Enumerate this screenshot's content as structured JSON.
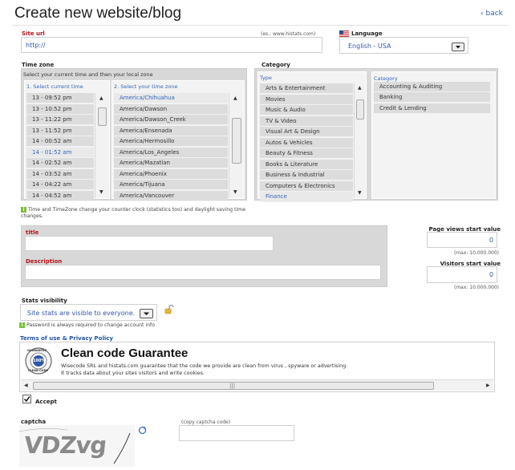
{
  "page": {
    "title": "Create new website/blog",
    "back_label": "back"
  },
  "site_url": {
    "label": "Site url",
    "example": "(es.: www.histats.com)",
    "value": "http://"
  },
  "language": {
    "label": "Language",
    "value": "English - USA"
  },
  "timezone": {
    "label": "Time zone",
    "instruction": "Select your current time and then your local zone",
    "col1_header": "1. Select current time",
    "col2_header": "2. Select your time zone",
    "times": [
      "13 - 09:52 pm",
      "13 - 10:52 pm",
      "13 - 11:22 pm",
      "13 - 11:52 pm",
      "14 - 00:52 am",
      "14 - 01:52 am",
      "14 - 02:52 am",
      "14 - 03:52 am",
      "14 - 04:22 am",
      "14 - 04:52 am"
    ],
    "zones": [
      "America/Chihuahua",
      "America/Dawson",
      "America/Dawson_Creek",
      "America/Ensenada",
      "America/Hermosillo",
      "America/Los_Angeles",
      "America/Mazatlan",
      "America/Phoenix",
      "America/Tijuana",
      "America/Vancouver"
    ],
    "note": "Time and TimeZone change your counter clock (statistics too) and daylight saving time changes."
  },
  "category": {
    "label": "Category",
    "type_header": "Type",
    "category_header": "Category",
    "types": [
      "Arts & Entertainment",
      "Movies",
      "Music & Audio",
      "TV & Video",
      "Visual Art & Design",
      "Autos & Vehicles",
      "Beauty & Fitness",
      "Books & Literature",
      "Business & Industrial",
      "Computers & Electronics",
      "Finance"
    ],
    "categories": [
      "Accounting & Auditing",
      "Banking",
      "Credit & Lending"
    ]
  },
  "title_field": {
    "label": "title",
    "value": ""
  },
  "description_field": {
    "label": "Description",
    "value": ""
  },
  "pageviews": {
    "label": "Page views start value",
    "value": "0",
    "max": "(max: 10.000.000)"
  },
  "visitors": {
    "label": "Visitors start value",
    "value": "0",
    "max": "(max: 10.000.000)"
  },
  "stats_visibility": {
    "label": "Stats visibility",
    "value": "Site stats are visible to everyone.",
    "note": "Password is always required to change account info"
  },
  "terms": {
    "link": "Terms of use & Privacy Policy",
    "heading": "Clean code Guarantee",
    "line1": "Wisecode SRL and histats.com guarantee that the code we provide are clean from virus , spyware or advertising.",
    "line2": "It tracks data about your sites visitors and write cookies.",
    "badge_top": "GUARANTEE",
    "badge_mid": "100%",
    "badge_bottom": "CLEAN CODE"
  },
  "accept": {
    "label": "Accept",
    "checked": true
  },
  "captcha": {
    "label": "captcha",
    "image_text": "VDZvg",
    "copy_label": "(copy captcha code)",
    "value": ""
  }
}
